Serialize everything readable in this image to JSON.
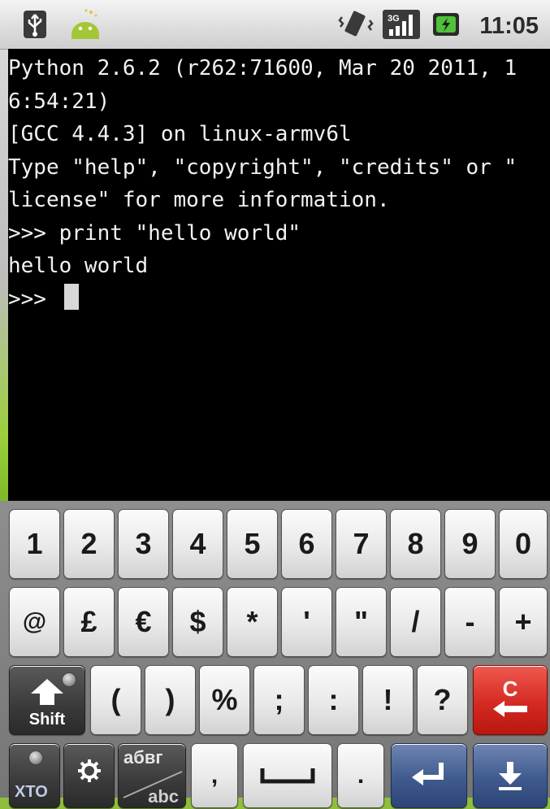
{
  "status_bar": {
    "time": "11:05",
    "icons": [
      "usb-icon",
      "android-icon",
      "vibrate-icon",
      "signal-3g-icon",
      "battery-charging-icon"
    ],
    "signal_label": "3G"
  },
  "terminal": {
    "lines": [
      "Python 2.6.2 (r262:71600, Mar 20 2011, 1",
      "6:54:21)",
      "[GCC 4.4.3] on linux-armv6l",
      "Type \"help\", \"copyright\", \"credits\" or \"",
      "license\" for more information.",
      ">>> print \"hello world\"",
      "hello world"
    ],
    "prompt": ">>> "
  },
  "keyboard": {
    "row1": [
      "1",
      "2",
      "3",
      "4",
      "5",
      "6",
      "7",
      "8",
      "9",
      "0"
    ],
    "row2": [
      "@",
      "£",
      "€",
      "$",
      "*",
      "'",
      "\"",
      "/",
      "-",
      "+"
    ],
    "row3": [
      "(",
      ")",
      "%",
      ";",
      ":",
      "!",
      "?"
    ],
    "shift_label": "Shift",
    "clear_label": "C",
    "alt_label": "абвг",
    "alt_sub_label": "abc",
    "xto_label": "XTO",
    "row4_keys": [
      ",",
      "."
    ],
    "colors": {
      "enter": "#3f5a8e",
      "clear": "#d42a22",
      "shift": "#3a3a3a"
    }
  }
}
